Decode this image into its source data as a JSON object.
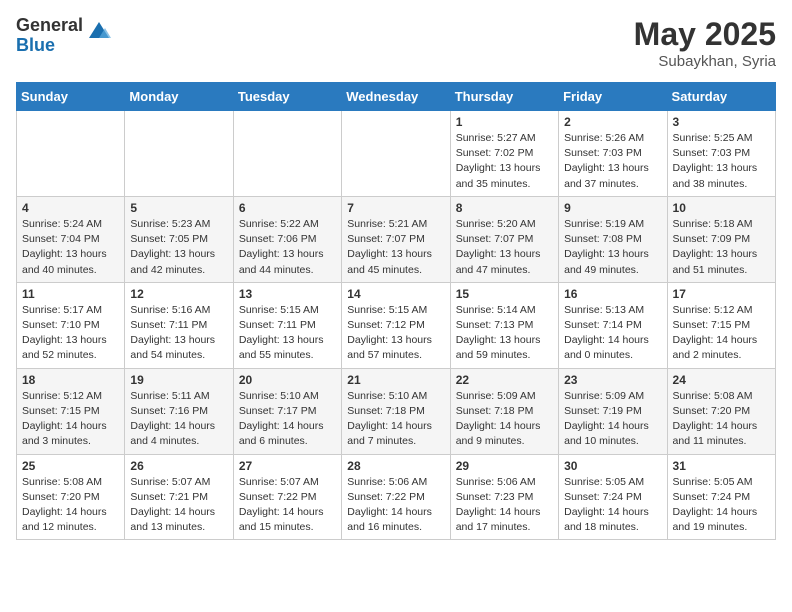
{
  "header": {
    "logo_general": "General",
    "logo_blue": "Blue",
    "month_title": "May 2025",
    "subtitle": "Subaykhan, Syria"
  },
  "weekdays": [
    "Sunday",
    "Monday",
    "Tuesday",
    "Wednesday",
    "Thursday",
    "Friday",
    "Saturday"
  ],
  "weeks": [
    [
      {
        "day": "",
        "info": ""
      },
      {
        "day": "",
        "info": ""
      },
      {
        "day": "",
        "info": ""
      },
      {
        "day": "",
        "info": ""
      },
      {
        "day": "1",
        "info": "Sunrise: 5:27 AM\nSunset: 7:02 PM\nDaylight: 13 hours\nand 35 minutes."
      },
      {
        "day": "2",
        "info": "Sunrise: 5:26 AM\nSunset: 7:03 PM\nDaylight: 13 hours\nand 37 minutes."
      },
      {
        "day": "3",
        "info": "Sunrise: 5:25 AM\nSunset: 7:03 PM\nDaylight: 13 hours\nand 38 minutes."
      }
    ],
    [
      {
        "day": "4",
        "info": "Sunrise: 5:24 AM\nSunset: 7:04 PM\nDaylight: 13 hours\nand 40 minutes."
      },
      {
        "day": "5",
        "info": "Sunrise: 5:23 AM\nSunset: 7:05 PM\nDaylight: 13 hours\nand 42 minutes."
      },
      {
        "day": "6",
        "info": "Sunrise: 5:22 AM\nSunset: 7:06 PM\nDaylight: 13 hours\nand 44 minutes."
      },
      {
        "day": "7",
        "info": "Sunrise: 5:21 AM\nSunset: 7:07 PM\nDaylight: 13 hours\nand 45 minutes."
      },
      {
        "day": "8",
        "info": "Sunrise: 5:20 AM\nSunset: 7:07 PM\nDaylight: 13 hours\nand 47 minutes."
      },
      {
        "day": "9",
        "info": "Sunrise: 5:19 AM\nSunset: 7:08 PM\nDaylight: 13 hours\nand 49 minutes."
      },
      {
        "day": "10",
        "info": "Sunrise: 5:18 AM\nSunset: 7:09 PM\nDaylight: 13 hours\nand 51 minutes."
      }
    ],
    [
      {
        "day": "11",
        "info": "Sunrise: 5:17 AM\nSunset: 7:10 PM\nDaylight: 13 hours\nand 52 minutes."
      },
      {
        "day": "12",
        "info": "Sunrise: 5:16 AM\nSunset: 7:11 PM\nDaylight: 13 hours\nand 54 minutes."
      },
      {
        "day": "13",
        "info": "Sunrise: 5:15 AM\nSunset: 7:11 PM\nDaylight: 13 hours\nand 55 minutes."
      },
      {
        "day": "14",
        "info": "Sunrise: 5:15 AM\nSunset: 7:12 PM\nDaylight: 13 hours\nand 57 minutes."
      },
      {
        "day": "15",
        "info": "Sunrise: 5:14 AM\nSunset: 7:13 PM\nDaylight: 13 hours\nand 59 minutes."
      },
      {
        "day": "16",
        "info": "Sunrise: 5:13 AM\nSunset: 7:14 PM\nDaylight: 14 hours\nand 0 minutes."
      },
      {
        "day": "17",
        "info": "Sunrise: 5:12 AM\nSunset: 7:15 PM\nDaylight: 14 hours\nand 2 minutes."
      }
    ],
    [
      {
        "day": "18",
        "info": "Sunrise: 5:12 AM\nSunset: 7:15 PM\nDaylight: 14 hours\nand 3 minutes."
      },
      {
        "day": "19",
        "info": "Sunrise: 5:11 AM\nSunset: 7:16 PM\nDaylight: 14 hours\nand 4 minutes."
      },
      {
        "day": "20",
        "info": "Sunrise: 5:10 AM\nSunset: 7:17 PM\nDaylight: 14 hours\nand 6 minutes."
      },
      {
        "day": "21",
        "info": "Sunrise: 5:10 AM\nSunset: 7:18 PM\nDaylight: 14 hours\nand 7 minutes."
      },
      {
        "day": "22",
        "info": "Sunrise: 5:09 AM\nSunset: 7:18 PM\nDaylight: 14 hours\nand 9 minutes."
      },
      {
        "day": "23",
        "info": "Sunrise: 5:09 AM\nSunset: 7:19 PM\nDaylight: 14 hours\nand 10 minutes."
      },
      {
        "day": "24",
        "info": "Sunrise: 5:08 AM\nSunset: 7:20 PM\nDaylight: 14 hours\nand 11 minutes."
      }
    ],
    [
      {
        "day": "25",
        "info": "Sunrise: 5:08 AM\nSunset: 7:20 PM\nDaylight: 14 hours\nand 12 minutes."
      },
      {
        "day": "26",
        "info": "Sunrise: 5:07 AM\nSunset: 7:21 PM\nDaylight: 14 hours\nand 13 minutes."
      },
      {
        "day": "27",
        "info": "Sunrise: 5:07 AM\nSunset: 7:22 PM\nDaylight: 14 hours\nand 15 minutes."
      },
      {
        "day": "28",
        "info": "Sunrise: 5:06 AM\nSunset: 7:22 PM\nDaylight: 14 hours\nand 16 minutes."
      },
      {
        "day": "29",
        "info": "Sunrise: 5:06 AM\nSunset: 7:23 PM\nDaylight: 14 hours\nand 17 minutes."
      },
      {
        "day": "30",
        "info": "Sunrise: 5:05 AM\nSunset: 7:24 PM\nDaylight: 14 hours\nand 18 minutes."
      },
      {
        "day": "31",
        "info": "Sunrise: 5:05 AM\nSunset: 7:24 PM\nDaylight: 14 hours\nand 19 minutes."
      }
    ]
  ]
}
